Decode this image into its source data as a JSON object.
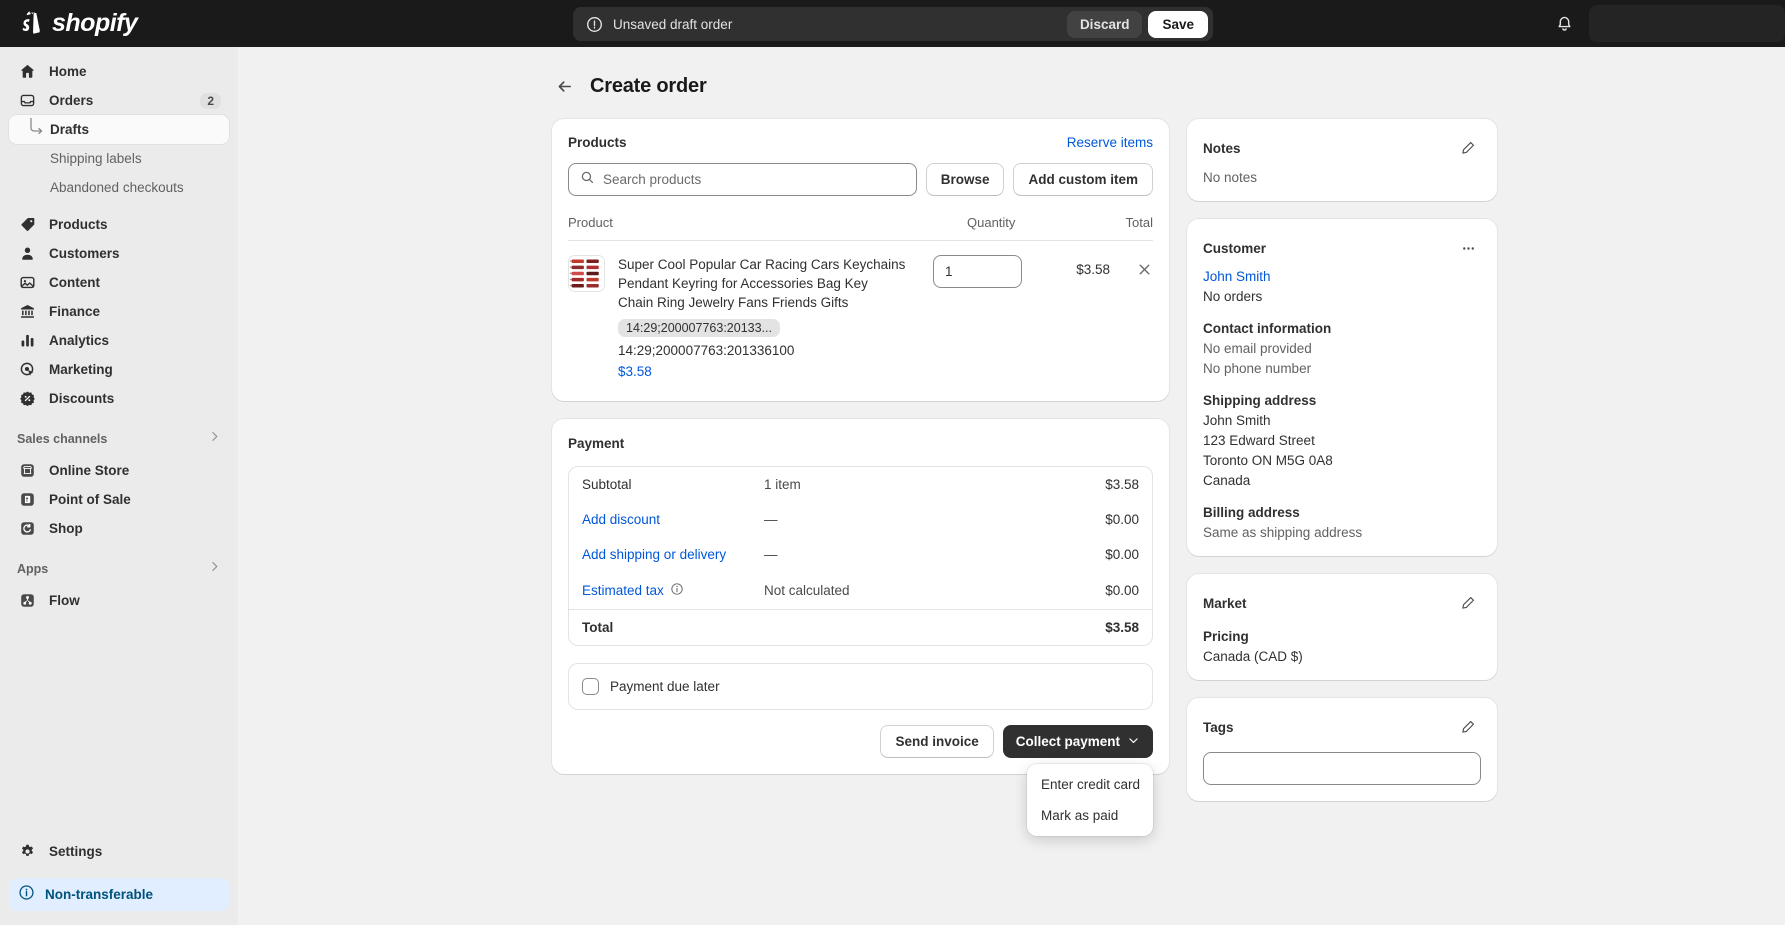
{
  "topbar": {
    "brand": "shopify",
    "savebar": {
      "message": "Unsaved draft order",
      "discard_label": "Discard",
      "save_label": "Save"
    }
  },
  "sidebar": {
    "items": [
      {
        "label": "Home",
        "icon": "home-icon"
      },
      {
        "label": "Orders",
        "icon": "orders-icon",
        "badge": "2"
      }
    ],
    "suborders": [
      {
        "label": "Drafts",
        "active": true
      },
      {
        "label": "Shipping labels",
        "active": false
      },
      {
        "label": "Abandoned checkouts",
        "active": false
      }
    ],
    "items2": [
      {
        "label": "Products",
        "icon": "tag-icon"
      },
      {
        "label": "Customers",
        "icon": "person-icon"
      },
      {
        "label": "Content",
        "icon": "content-icon"
      },
      {
        "label": "Finance",
        "icon": "bank-icon"
      },
      {
        "label": "Analytics",
        "icon": "chart-icon"
      },
      {
        "label": "Marketing",
        "icon": "marketing-icon"
      },
      {
        "label": "Discounts",
        "icon": "discount-icon"
      }
    ],
    "sales_channels_title": "Sales channels",
    "channels": [
      {
        "label": "Online Store",
        "icon": "store-icon"
      },
      {
        "label": "Point of Sale",
        "icon": "pos-icon"
      },
      {
        "label": "Shop",
        "icon": "shop-icon"
      }
    ],
    "apps_title": "Apps",
    "apps": [
      {
        "label": "Flow",
        "icon": "flow-icon"
      }
    ],
    "settings_label": "Settings",
    "non_transferable_label": "Non-transferable"
  },
  "page": {
    "title": "Create order"
  },
  "products": {
    "title": "Products",
    "reserve_link": "Reserve items",
    "search_placeholder": "Search products",
    "browse_label": "Browse",
    "add_custom_label": "Add custom item",
    "col_product": "Product",
    "col_quantity": "Quantity",
    "col_total": "Total",
    "item": {
      "title": "Super Cool Popular Car Racing Cars Keychains Pendant Keyring for Accessories Bag Key Chain Ring Jewelry Fans Friends Gifts",
      "variant_badge": "14:29;200007763:20133...",
      "sku": "14:29;200007763:201336100",
      "unit_price": "$3.58",
      "quantity": "1",
      "total": "$3.58"
    }
  },
  "payment": {
    "title": "Payment",
    "rows": [
      {
        "label": "Subtotal",
        "mid": "1 item",
        "amount": "$3.58",
        "link": false
      },
      {
        "label": "Add discount",
        "mid": "—",
        "amount": "$0.00",
        "link": true
      },
      {
        "label": "Add shipping or delivery",
        "mid": "—",
        "amount": "$0.00",
        "link": true
      },
      {
        "label": "Estimated tax",
        "mid": "Not calculated",
        "amount": "$0.00",
        "link": true,
        "info": true
      }
    ],
    "total_label": "Total",
    "total_amount": "$3.58",
    "due_later_label": "Payment due later",
    "send_invoice_label": "Send invoice",
    "collect_payment_label": "Collect payment",
    "menu": [
      "Enter credit card",
      "Mark as paid"
    ]
  },
  "notes": {
    "title": "Notes",
    "empty": "No notes"
  },
  "customer": {
    "title": "Customer",
    "name": "John Smith",
    "orders": "No orders",
    "contact_title": "Contact information",
    "email": "No email provided",
    "phone": "No phone number",
    "shipping_title": "Shipping address",
    "shipping": [
      "John Smith",
      "123 Edward Street",
      "Toronto ON M5G 0A8",
      "Canada"
    ],
    "billing_title": "Billing address",
    "billing": "Same as shipping address"
  },
  "market": {
    "title": "Market",
    "pricing_label": "Pricing",
    "pricing_value": "Canada (CAD $)"
  },
  "tags": {
    "title": "Tags",
    "value": ""
  },
  "colors": {
    "accent": "#0057d9",
    "dark": "#1a1a1a",
    "info_bg": "#e0eeff",
    "info_text": "#00527c"
  }
}
